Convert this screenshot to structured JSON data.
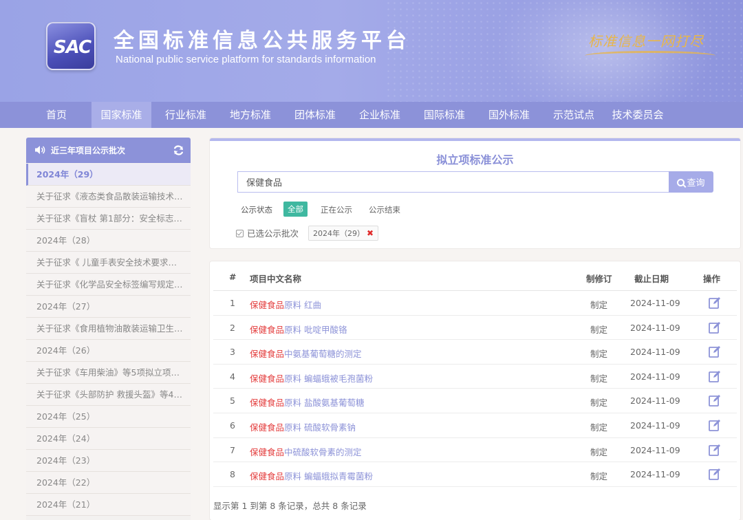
{
  "header": {
    "logo_text": "SAC",
    "title": "全国标准信息公共服务平台",
    "subtitle": "National public service platform  for standards information",
    "slogan": "标准信息一网打尽"
  },
  "nav": {
    "items": [
      "首页",
      "国家标准",
      "行业标准",
      "地方标准",
      "团体标准",
      "企业标准",
      "国际标准",
      "国外标准",
      "示范试点",
      "技术委员会"
    ],
    "active_index": 1
  },
  "sidebar": {
    "title": "近三年项目公示批次",
    "rows": [
      {
        "text": "2024年（29）",
        "type": "year",
        "active": true
      },
      {
        "text": "关于征求《液态类食品散装运输技术…",
        "type": "item"
      },
      {
        "text": "关于征求《盲杖 第1部分：安全标志…",
        "type": "item"
      },
      {
        "text": "2024年（28）",
        "type": "year"
      },
      {
        "text": "关于征求《 儿童手表安全技术要求》…",
        "type": "item"
      },
      {
        "text": "关于征求《化学品安全标签编写规定…",
        "type": "item"
      },
      {
        "text": "2024年（27）",
        "type": "year"
      },
      {
        "text": "关于征求《食用植物油散装运输卫生…",
        "type": "item"
      },
      {
        "text": "2024年（26）",
        "type": "year"
      },
      {
        "text": "关于征求《车用柴油》等5项拟立项…",
        "type": "item"
      },
      {
        "text": "关于征求《头部防护 救援头盔》等44…",
        "type": "item"
      },
      {
        "text": "2024年（25）",
        "type": "year"
      },
      {
        "text": "2024年（24）",
        "type": "year"
      },
      {
        "text": "2024年（23）",
        "type": "year"
      },
      {
        "text": "2024年（22）",
        "type": "year"
      },
      {
        "text": "2024年（21）",
        "type": "year"
      }
    ]
  },
  "search": {
    "panel_title": "拟立项标准公示",
    "query": "保健食品",
    "button_label": "查询",
    "status_label": "公示状态",
    "filters": {
      "all": "全部",
      "ongoing": "正在公示",
      "ended": "公示结束"
    },
    "selected_label": "已选公示批次",
    "selected_chip": "2024年（29）",
    "chip_remove": "✖"
  },
  "table": {
    "headers": {
      "num": "#",
      "name": "项目中文名称",
      "revision": "制修订",
      "deadline": "截止日期",
      "action": "操作"
    },
    "rows": [
      {
        "num": "1",
        "hl": "保健食品",
        "rest": "原料 红曲",
        "revision": "制定",
        "deadline": "2024-11-09"
      },
      {
        "num": "2",
        "hl": "保健食品",
        "rest": "原料 吡啶甲酸铬",
        "revision": "制定",
        "deadline": "2024-11-09"
      },
      {
        "num": "3",
        "hl": "保健食品",
        "rest": "中氨基葡萄糖的测定",
        "revision": "制定",
        "deadline": "2024-11-09"
      },
      {
        "num": "4",
        "hl": "保健食品",
        "rest": "原料 蝙蝠蛾被毛孢菌粉",
        "revision": "制定",
        "deadline": "2024-11-09"
      },
      {
        "num": "5",
        "hl": "保健食品",
        "rest": "原料 盐酸氨基葡萄糖",
        "revision": "制定",
        "deadline": "2024-11-09"
      },
      {
        "num": "6",
        "hl": "保健食品",
        "rest": "原料 硫酸软骨素钠",
        "revision": "制定",
        "deadline": "2024-11-09"
      },
      {
        "num": "7",
        "hl": "保健食品",
        "rest": "中硫酸软骨素的测定",
        "revision": "制定",
        "deadline": "2024-11-09"
      },
      {
        "num": "8",
        "hl": "保健食品",
        "rest": "原料 蝙蝠蛾拟青霉菌粉",
        "revision": "制定",
        "deadline": "2024-11-09"
      }
    ],
    "footer": "显示第 1 到第 8 条记录，总共 8 条记录"
  },
  "colors": {
    "accent": "#8c92d9",
    "highlight": "#e33b3b",
    "link": "#8d93d8",
    "active_filter": "#3fb8a0"
  }
}
